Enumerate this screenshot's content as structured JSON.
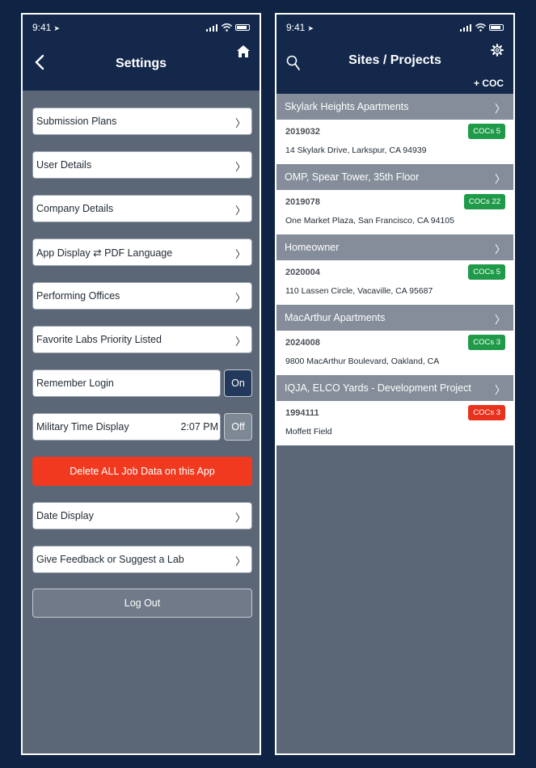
{
  "settings_screen": {
    "status_time": "9:41",
    "title": "Settings",
    "rows": [
      {
        "label": "Submission Plans"
      },
      {
        "label": "User Details"
      },
      {
        "label": "Company Details"
      },
      {
        "label": "App Display ⇄ PDF Language"
      },
      {
        "label": "Performing Offices"
      },
      {
        "label": "Favorite Labs Priority Listed"
      }
    ],
    "remember_login": {
      "label": "Remember Login",
      "toggle": "On"
    },
    "military_time": {
      "label": "Military Time Display",
      "value": "2:07 PM",
      "toggle": "Off"
    },
    "delete_button": "Delete ALL Job Data on this App",
    "rows_after": [
      {
        "label": "Date Display"
      },
      {
        "label": "Give Feedback or Suggest a Lab"
      }
    ],
    "logout_button": "Log Out"
  },
  "projects_screen": {
    "status_time": "9:41",
    "title": "Sites / Projects",
    "add_coc_label": "+ COC",
    "projects": [
      {
        "name": "Skylark Heights Apartments",
        "number": "2019032",
        "address": "14 Skylark Drive, Larkspur, CA 94939",
        "badge": "COCs 5",
        "badge_color": "#1f9a49"
      },
      {
        "name": "OMP, Spear Tower, 35th Floor",
        "number": "2019078",
        "address": "One Market Plaza, San Francisco, CA 94105",
        "badge": "COCs 22",
        "badge_color": "#1f9a49"
      },
      {
        "name": "Homeowner",
        "number": "2020004",
        "address": "110 Lassen Circle, Vacaville, CA 95687",
        "badge": "COCs 5",
        "badge_color": "#1f9a49"
      },
      {
        "name": "MacArthur Apartments",
        "number": "2024008",
        "address": "9800 MacArthur Boulevard, Oakland, CA",
        "badge": "COCs 3",
        "badge_color": "#1f9a49"
      },
      {
        "name": "IQJA, ELCO Yards - Development Project",
        "number": "1994111",
        "address": "Moffett Field",
        "badge": "COCs 3",
        "badge_color": "#e8321e"
      }
    ]
  },
  "colors": {
    "navy": "#13284b",
    "screen_bg": "#5b6676",
    "accent_red": "#f0391e",
    "badge_green": "#1f9a49"
  },
  "icons": [
    "location-arrow-icon",
    "signal-icon",
    "wifi-icon",
    "battery-icon",
    "chevron-left-icon",
    "home-icon",
    "search-icon",
    "gear-icon",
    "chevron-right-icon"
  ]
}
